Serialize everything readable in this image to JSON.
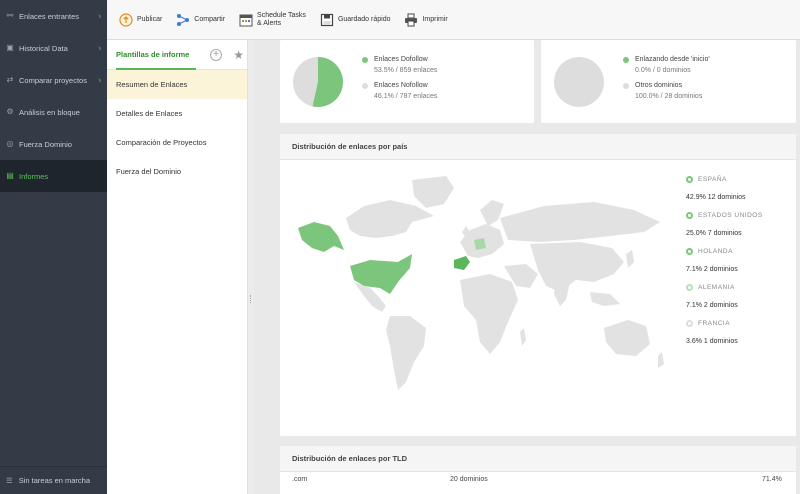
{
  "nav": {
    "items": [
      {
        "label": "Enlaces entrantes",
        "icon": "link-icon",
        "has_chevron": true
      },
      {
        "label": "Historical Data",
        "icon": "history-icon",
        "has_chevron": true
      },
      {
        "label": "Comparar proyectos",
        "icon": "compare-icon",
        "has_chevron": true
      },
      {
        "label": "Análisis en bloque",
        "icon": "bulk-analysis-icon",
        "has_chevron": false
      },
      {
        "label": "Fuerza Dominio",
        "icon": "domain-strength-icon",
        "has_chevron": false
      },
      {
        "label": "Informes",
        "icon": "reports-icon",
        "has_chevron": false,
        "active": true
      }
    ],
    "status": "Sin tareas en marcha"
  },
  "toolbar": {
    "publish": "Publicar",
    "share": "Compartir",
    "schedule_line1": "Schedule Tasks",
    "schedule_line2": "& Alerts",
    "quick_save": "Guardado rápido",
    "print": "Imprimir"
  },
  "templates": {
    "title": "Plantillas de informe",
    "items": [
      "Resumen de Enlaces",
      "Detalles de Enlaces",
      "Comparación de Proyectos",
      "Fuerza del Dominio"
    ],
    "selected_index": 0
  },
  "pie_cards": [
    {
      "legend": [
        {
          "label": "Enlaces Dofollow",
          "value": "53.5% / 859 enlaces",
          "color": "#7cc57c"
        },
        {
          "label": "Enlaces Nofollow",
          "value": "46.1% / 787 enlaces",
          "color": "#dddddd"
        }
      ],
      "slices": [
        53.5,
        46.1
      ]
    },
    {
      "legend": [
        {
          "label": "Enlazando desde 'inicio'",
          "value": "0.0% / 0 dominios",
          "color": "#7cc57c"
        },
        {
          "label": "Otros dominios",
          "value": "100.0% / 28 dominios",
          "color": "#dddddd"
        }
      ],
      "slices": [
        0,
        100
      ]
    }
  ],
  "map_card": {
    "title": "Distribución de enlaces por país",
    "countries": [
      {
        "name": "ESPAÑA",
        "value": "42.9% 12 dominios"
      },
      {
        "name": "ESTADOS UNIDOS",
        "value": "25.0% 7 dominios"
      },
      {
        "name": "HOLANDA",
        "value": "7.1% 2 dominios"
      },
      {
        "name": "ALEMANIA",
        "value": "7.1% 2 dominios"
      },
      {
        "name": "FRANCIA",
        "value": "3.6% 1 dominios"
      }
    ]
  },
  "tld_card": {
    "title": "Distribución de enlaces por TLD",
    "rows": [
      {
        "tld": ".com",
        "count": "20 dominios",
        "percent": "71.4%"
      }
    ]
  },
  "colors": {
    "accent": "#5bb55b",
    "nav_bg": "#333b46",
    "nav_active": "#1f252c"
  }
}
